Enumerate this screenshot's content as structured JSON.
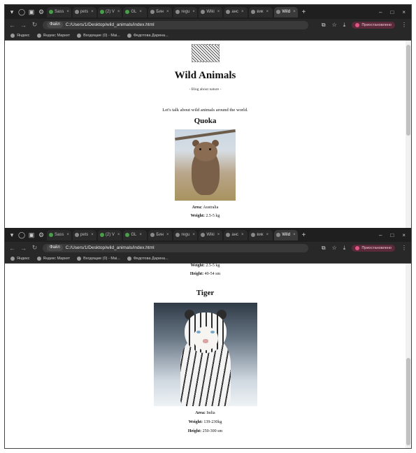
{
  "browser_top": {
    "tabs": [
      {
        "label": "Sass",
        "active": false
      },
      {
        "label": "pets",
        "active": false
      },
      {
        "label": "(2) V",
        "active": false
      },
      {
        "label": "GL",
        "active": false
      },
      {
        "label": "Бин",
        "active": false
      },
      {
        "label": "regu",
        "active": false
      },
      {
        "label": "Wiki",
        "active": false
      },
      {
        "label": "анс",
        "active": false
      },
      {
        "label": "вик",
        "active": false
      },
      {
        "label": "Wild",
        "active": true
      }
    ],
    "address": {
      "chip": "Файл",
      "url": "C:/Users/1/Desktop/wild_animals/index.html"
    },
    "paused_label": "Приостановлено",
    "bookmarks": [
      "Яндекс",
      "Яндекс Маркет",
      "Входящие (0) - Mai...",
      "Федотова Дарина..."
    ]
  },
  "browser_bottom": {
    "tabs": [
      {
        "label": "Sass",
        "active": false
      },
      {
        "label": "pets",
        "active": false
      },
      {
        "label": "(2) V",
        "active": false
      },
      {
        "label": "GL",
        "active": false
      },
      {
        "label": "Бин",
        "active": false
      },
      {
        "label": "regu",
        "active": false
      },
      {
        "label": "Wiki",
        "active": false
      },
      {
        "label": "анс",
        "active": false
      },
      {
        "label": "вик",
        "active": false
      },
      {
        "label": "Wild",
        "active": true
      }
    ],
    "address": {
      "chip": "Файл",
      "url": "C:/Users/1/Desktop/wild_animals/index.html"
    },
    "paused_label": "Приостановлено",
    "bookmarks": [
      "Яндекс",
      "Яндекс Маркет",
      "Входящие (0) - Mai...",
      "Федотова Дарина..."
    ]
  },
  "page": {
    "title": "Wild Animals",
    "tagline": "- Blog about nature -",
    "intro": "Let's talk about wild animals around the world.",
    "animals": [
      {
        "name": "Quoka",
        "area_label": "Area:",
        "area": "Australia",
        "weight_label": "Weight:",
        "weight": "2.5-5 kg",
        "height_label": "Height:",
        "height": "40-54 sm"
      },
      {
        "name": "Tiger",
        "area_label": "Area:",
        "area": "India",
        "weight_label": "Weight:",
        "weight": "139-230kg",
        "height_label": "Height:",
        "height": "250-300 sm"
      }
    ]
  },
  "colors": {
    "chrome_dark": "#1f1f1f",
    "paused_accent": "#e05582",
    "scrollbar_thumb": "#c1c1c1"
  }
}
